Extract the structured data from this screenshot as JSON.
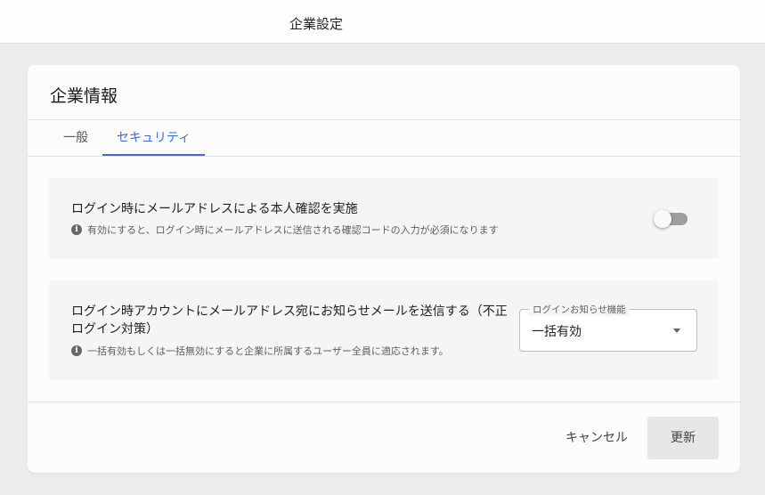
{
  "header": {
    "title": "企業設定"
  },
  "card": {
    "title": "企業情報",
    "tabs": [
      {
        "label": "一般",
        "active": false
      },
      {
        "label": "セキュリティ",
        "active": true
      }
    ]
  },
  "security": {
    "email_verification": {
      "title": "ログイン時にメールアドレスによる本人確認を実施",
      "hint": "有効にすると、ログイン時にメールアドレスに送信される確認コードの入力が必須になります",
      "enabled": false
    },
    "login_notification": {
      "title": "ログイン時アカウントにメールアドレス宛にお知らせメールを送信する（不正ログイン対策）",
      "hint": "一括有効もしくは一括無効にすると企業に所属するユーザー全員に適応されます。",
      "select_label": "ログインお知らせ機能",
      "select_value": "一括有効"
    }
  },
  "footer": {
    "cancel_label": "キャンセル",
    "update_label": "更新"
  },
  "colors": {
    "accent": "#3d6be0",
    "panel_bg": "#f4f5f7",
    "page_bg": "#ececec"
  },
  "icons": {
    "info": "info-icon",
    "dropdown": "chevron-down-icon"
  }
}
